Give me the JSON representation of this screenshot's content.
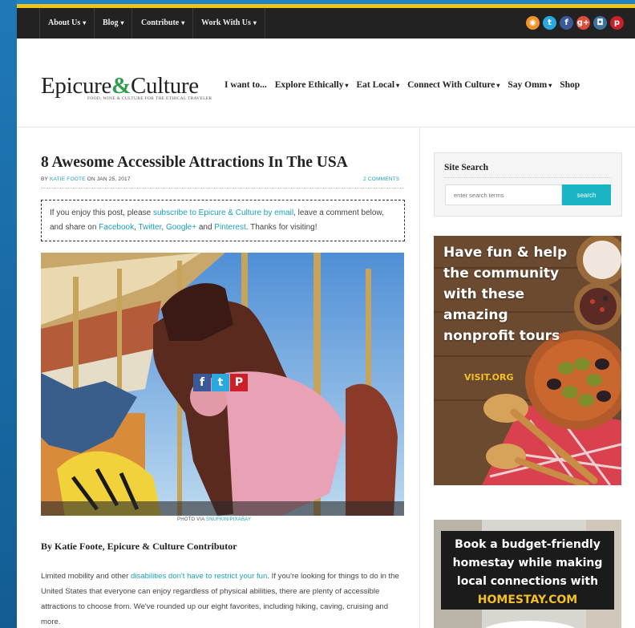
{
  "topnav": {
    "items": [
      {
        "label": "About Us"
      },
      {
        "label": "Blog"
      },
      {
        "label": "Contribute"
      },
      {
        "label": "Work With Us"
      }
    ],
    "social_icons": [
      {
        "name": "rss-icon",
        "glyph": "◉",
        "color": "#f0932b"
      },
      {
        "name": "twitter-icon",
        "glyph": "t",
        "color": "#2aa9e0"
      },
      {
        "name": "facebook-icon",
        "glyph": "f",
        "color": "#3b5998"
      },
      {
        "name": "google-plus-icon",
        "glyph": "g+",
        "color": "#dd4b39"
      },
      {
        "name": "instagram-icon",
        "glyph": "◘",
        "color": "#3f729b"
      },
      {
        "name": "pinterest-icon",
        "glyph": "p",
        "color": "#cb2027"
      }
    ]
  },
  "header": {
    "logo_part1": "Epicure",
    "logo_amp": "&",
    "logo_part2": "Culture",
    "tagline": "FOOD, WINE & CULTURE FOR THE ETHICAL TRAVELER",
    "nav": [
      {
        "label": "I want to...",
        "dropdown": false
      },
      {
        "label": "Explore Ethically",
        "dropdown": true
      },
      {
        "label": "Eat Local",
        "dropdown": true
      },
      {
        "label": "Connect With Culture",
        "dropdown": true
      },
      {
        "label": "Say Omm",
        "dropdown": true
      },
      {
        "label": "Shop",
        "dropdown": false
      }
    ]
  },
  "post": {
    "title": "8 Awesome Accessible Attractions In The USA",
    "byline_prefix": "BY",
    "author": "KATIE FOOTE",
    "date": "ON JAN 25, 2017",
    "comments": "2 COMMENTS",
    "notice": {
      "t1": "If you enjoy this post, please ",
      "l1": "subscribe to Epicure & Culture by email",
      "t2": ", leave a comment below, and share on ",
      "l2": "Facebook",
      "t3": ", ",
      "l3": "Twitter",
      "t4": ", ",
      "l4": "Google+",
      "t5": " and ",
      "l5": "Pinterest",
      "t6": ". Thanks for visiting!"
    },
    "share": [
      {
        "name": "share-facebook-icon",
        "glyph": "f",
        "color": "#3b5998"
      },
      {
        "name": "share-twitter-icon",
        "glyph": "t",
        "color": "#2aa9e0"
      },
      {
        "name": "share-pinterest-icon",
        "glyph": "P",
        "color": "#cb2027"
      }
    ],
    "photo_credit_prefix": "PHOTO VIA ",
    "photo_credit_link": "SNUFKIN/PIXABAY",
    "subhead": "By Katie Foote, Epicure & Culture Contributor",
    "para": {
      "t1": "Limited mobility and other ",
      "l1": "disabilities don't have to restrict your fun",
      "t2": ". If you're looking for things to do in the United States that everyone can enjoy regardless of physical abilities, there are plenty of accessible attractions to choose from. We've rounded up our eight favorites, including hiking, caving, cruising and more."
    }
  },
  "sidebar": {
    "search_title": "Site Search",
    "search_placeholder": "enter search terms",
    "search_button": "search",
    "ad1_text": "Have fun & help the community with these amazing nonprofit tours",
    "ad1_cta": "VISIT.ORG",
    "ad2_text": "Book a budget-friendly homestay while making local connections with",
    "ad2_brand": "HOMESTAY.COM"
  }
}
